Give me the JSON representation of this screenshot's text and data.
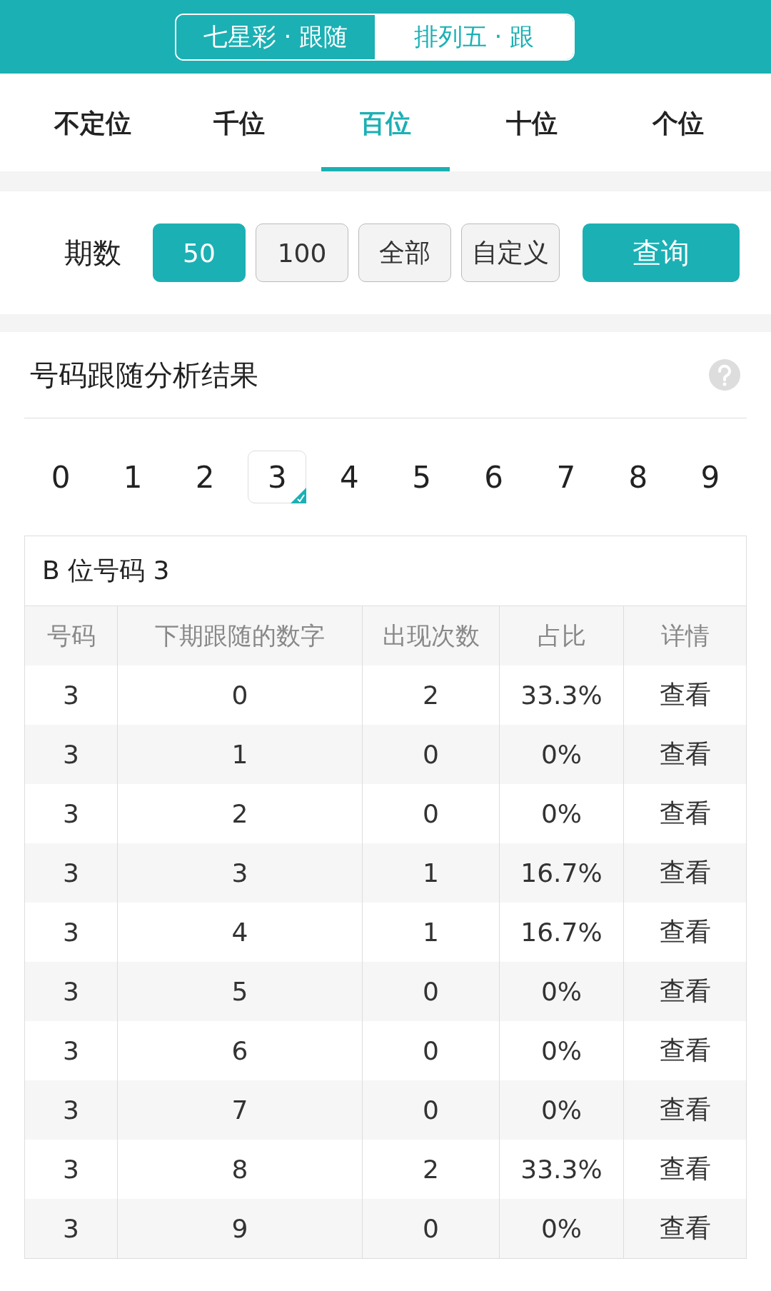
{
  "top_switch": [
    {
      "label": "七星彩 · 跟随",
      "selected": true
    },
    {
      "label": "排列五 · 跟",
      "selected": false
    }
  ],
  "position_tabs": [
    {
      "label": "不定位",
      "selected": false
    },
    {
      "label": "千位",
      "selected": false
    },
    {
      "label": "百位",
      "selected": true
    },
    {
      "label": "十位",
      "selected": false
    },
    {
      "label": "个位",
      "selected": false
    }
  ],
  "period": {
    "label": "期数",
    "options": [
      {
        "label": "50",
        "selected": true
      },
      {
        "label": "100",
        "selected": false
      },
      {
        "label": "全部",
        "selected": false
      },
      {
        "label": "自定义",
        "selected": false
      }
    ],
    "query_button": "查询"
  },
  "result": {
    "title": "号码跟随分析结果",
    "digits": [
      {
        "label": "0",
        "selected": false
      },
      {
        "label": "1",
        "selected": false
      },
      {
        "label": "2",
        "selected": false
      },
      {
        "label": "3",
        "selected": true
      },
      {
        "label": "4",
        "selected": false
      },
      {
        "label": "5",
        "selected": false
      },
      {
        "label": "6",
        "selected": false
      },
      {
        "label": "7",
        "selected": false
      },
      {
        "label": "8",
        "selected": false
      },
      {
        "label": "9",
        "selected": false
      }
    ],
    "table": {
      "title": "B 位号码 3",
      "columns": [
        "号码",
        "下期跟随的数字",
        "出现次数",
        "占比",
        "详情"
      ],
      "rows": [
        [
          "3",
          "0",
          "2",
          "33.3%",
          "查看"
        ],
        [
          "3",
          "1",
          "0",
          "0%",
          "查看"
        ],
        [
          "3",
          "2",
          "0",
          "0%",
          "查看"
        ],
        [
          "3",
          "3",
          "1",
          "16.7%",
          "查看"
        ],
        [
          "3",
          "4",
          "1",
          "16.7%",
          "查看"
        ],
        [
          "3",
          "5",
          "0",
          "0%",
          "查看"
        ],
        [
          "3",
          "6",
          "0",
          "0%",
          "查看"
        ],
        [
          "3",
          "7",
          "0",
          "0%",
          "查看"
        ],
        [
          "3",
          "8",
          "2",
          "33.3%",
          "查看"
        ],
        [
          "3",
          "9",
          "0",
          "0%",
          "查看"
        ]
      ]
    }
  }
}
